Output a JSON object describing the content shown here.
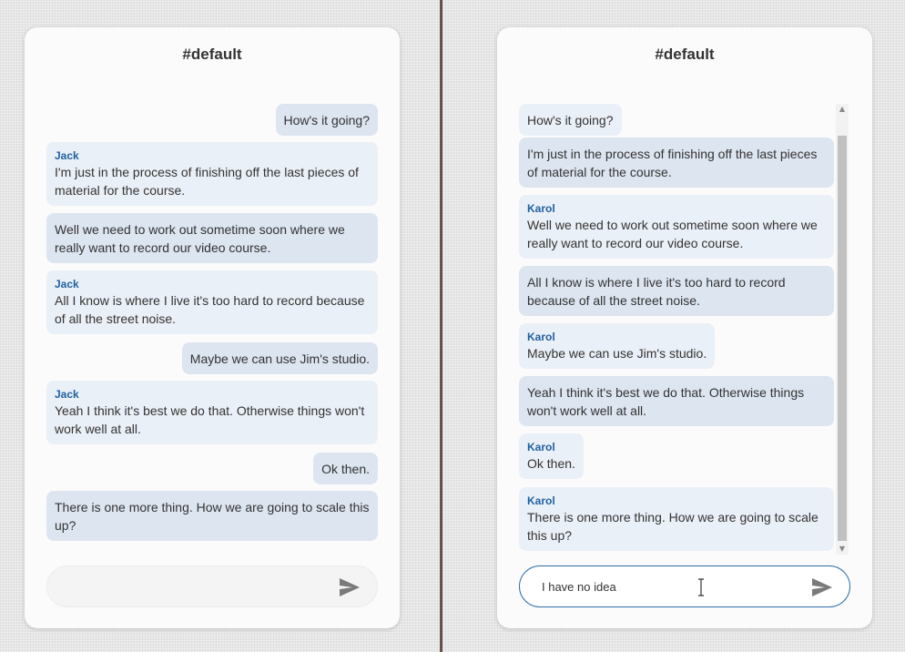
{
  "left": {
    "title": "#default",
    "messages": [
      {
        "text": "How's it going?"
      },
      {
        "sender": "Jack",
        "text": "I'm just in the process of finishing off the last pieces of material for the course."
      },
      {
        "text": "Well we need to work out sometime soon where we really want to record our video course."
      },
      {
        "sender": "Jack",
        "text": "All I know is where I live it's too hard to record because of all the street noise."
      },
      {
        "text": "Maybe we can use Jim's studio."
      },
      {
        "sender": "Jack",
        "text": "Yeah I think it's best we do that. Otherwise things won't work well at all."
      },
      {
        "text": "Ok then."
      },
      {
        "text": "There is one more thing. How we are going to scale this up?"
      }
    ],
    "composer": {
      "value": "",
      "send_icon": "send-icon"
    }
  },
  "right": {
    "title": "#default",
    "messages": [
      {
        "text": "How's it going?"
      },
      {
        "text": "I'm just in the process of finishing off the last pieces of material for the course."
      },
      {
        "sender": "Karol",
        "text": "Well we need to work out sometime soon where we really want to record our video course."
      },
      {
        "text": "All I know is where I live it's too hard to record because of all the street noise."
      },
      {
        "sender": "Karol",
        "text": "Maybe we can use Jim's studio."
      },
      {
        "text": "Yeah I think it's best we do that. Otherwise things won't work well at all."
      },
      {
        "sender": "Karol",
        "text": "Ok then."
      },
      {
        "sender": "Karol",
        "text": "There is one more thing. How we are going to scale this up?"
      }
    ],
    "composer": {
      "value": "I have no idea",
      "send_icon": "send-icon"
    }
  },
  "colors": {
    "sender_name": "#1f5f9e",
    "bubble_in": "#eaf0f7",
    "bubble_out": "#dde5f0",
    "focus_border": "#2f6ea8"
  }
}
